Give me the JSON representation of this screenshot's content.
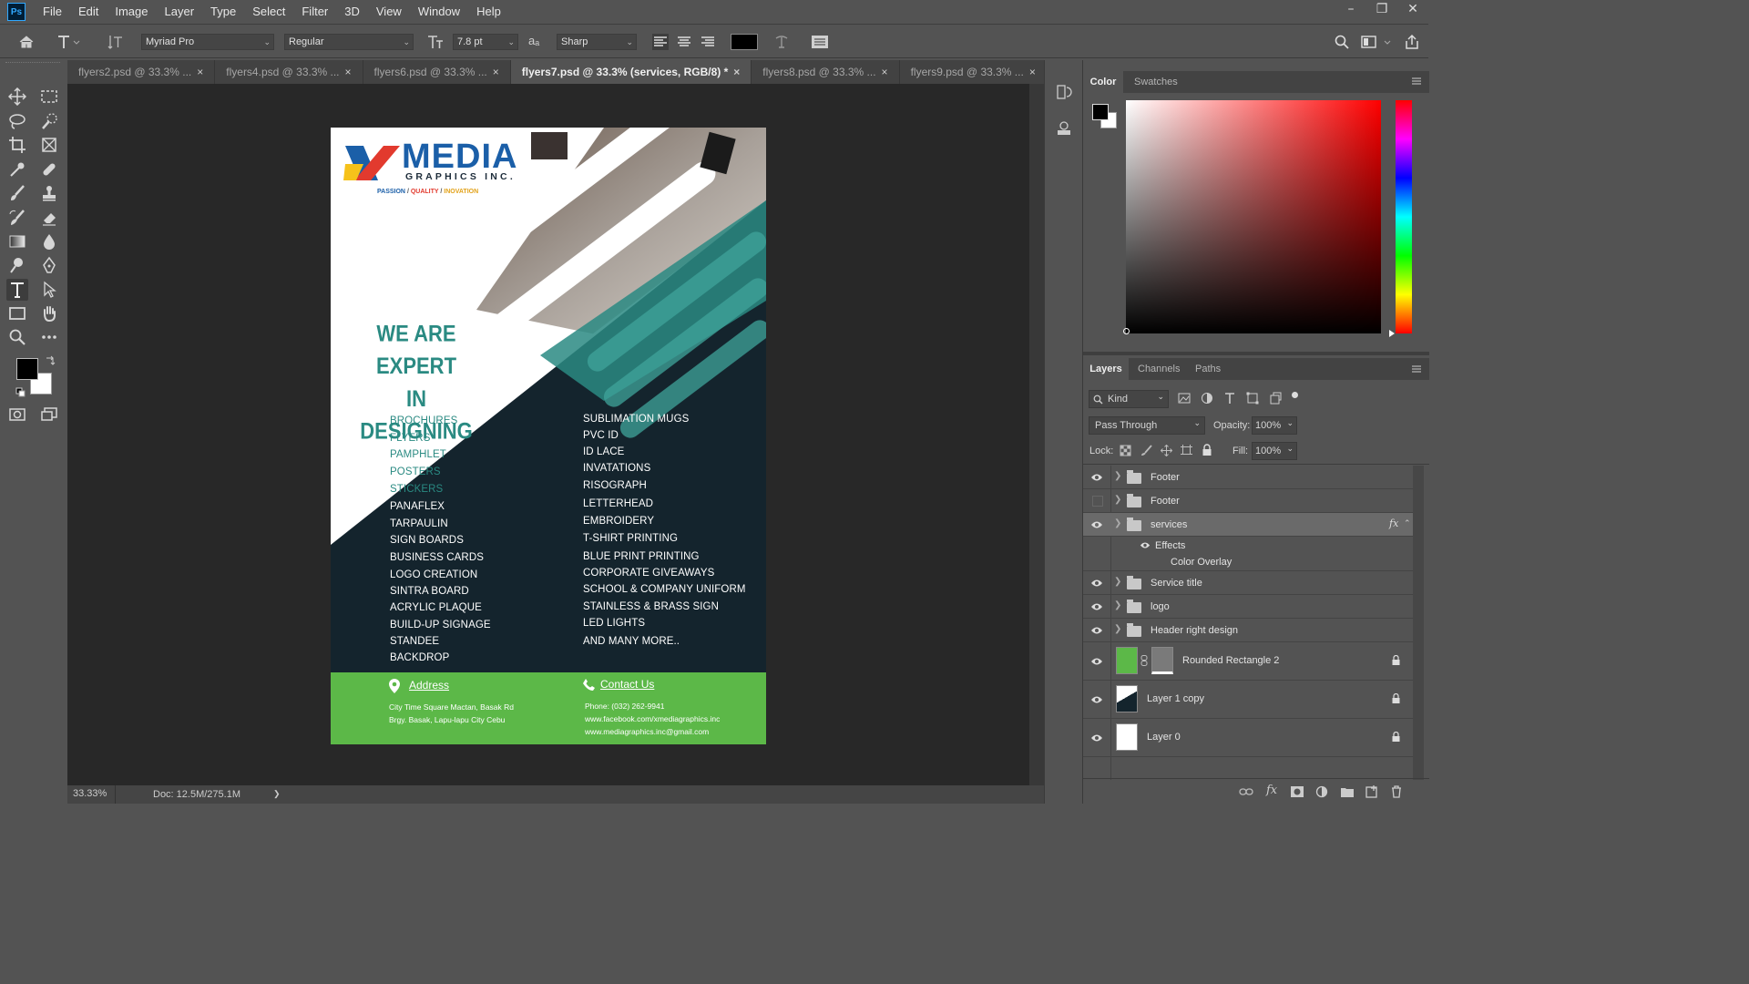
{
  "app": {
    "logo": "Ps"
  },
  "menu": [
    "File",
    "Edit",
    "Image",
    "Layer",
    "Type",
    "Select",
    "Filter",
    "3D",
    "View",
    "Window",
    "Help"
  ],
  "window_controls": [
    "–",
    "❐",
    "✕"
  ],
  "options": {
    "font_family": "Myriad Pro",
    "font_style": "Regular",
    "font_size": "7.8 pt",
    "aa_label": "aₐ",
    "antialias": "Sharp",
    "color": "#000000"
  },
  "tabs": [
    {
      "label": "flyers2.psd @ 33.3% ...",
      "active": false
    },
    {
      "label": "flyers4.psd @ 33.3% ...",
      "active": false
    },
    {
      "label": "flyers6.psd @ 33.3% ...",
      "active": false
    },
    {
      "label": "flyers7.psd @ 33.3% (services, RGB/8) *",
      "active": true
    },
    {
      "label": "flyers8.psd @ 33.3% ...",
      "active": false
    },
    {
      "label": "flyers9.psd @ 33.3% ...",
      "active": false
    }
  ],
  "tab_close": "×",
  "flyer": {
    "logo_main": "MEDIA",
    "logo_sub": "GRAPHICS INC.",
    "tagline": {
      "p1": "PASSION",
      "p2": "QUALITY",
      "p3": "INOVATION",
      "sep": " / "
    },
    "headline_1": "WE ARE EXPERT",
    "headline_2": "IN DESIGNING",
    "services_left": [
      "BROCHURES",
      "FLYERS",
      "PAMPHLET",
      "POSTERS",
      "STICKERS",
      "PANAFLEX",
      "TARPAULIN",
      "SIGN BOARDS",
      "BUSINESS CARDS",
      "LOGO CREATION",
      "SINTRA BOARD",
      "ACRYLIC PLAQUE",
      "BUILD-UP SIGNAGE",
      "STANDEE",
      "BACKDROP"
    ],
    "services_right": [
      "SUBLIMATION MUGS",
      "PVC ID",
      "ID LACE",
      "INVATATIONS",
      "RISOGRAPH",
      "LETTERHEAD",
      "EMBROIDERY",
      "T-SHIRT PRINTING",
      "BLUE PRINT PRINTING",
      "CORPORATE GIVEAWAYS",
      "SCHOOL & COMPANY UNIFORM",
      "STAINLESS & BRASS SIGN",
      "LED LIGHTS",
      "AND MANY MORE.."
    ],
    "address_title": "Address",
    "address_1": "City Time Square Mactan, Basak Rd",
    "address_2": "Brgy. Basak, Lapu-lapu City Cebu",
    "contact_title": "Contact Us",
    "phone": "Phone: (032) 262-9941",
    "facebook": "www.facebook.com/xmediagraphics.inc",
    "email": "www.mediagraphics.inc@gmail.com",
    "colors": {
      "navy": "#14242d",
      "teal": "#2a8a82",
      "green": "#5cb848",
      "logo_blue": "#1b5fa8"
    }
  },
  "status": {
    "zoom": "33.33%",
    "doc": "Doc: 12.5M/275.1M",
    "arrow": "❯"
  },
  "color_panel": {
    "tabs": [
      "Color",
      "Swatches"
    ],
    "hue_color": "#ff0000"
  },
  "layers_panel": {
    "tabs": [
      "Layers",
      "Channels",
      "Paths"
    ],
    "filter": "Kind",
    "blend_mode": "Pass Through",
    "opacity_label": "Opacity:",
    "opacity": "100%",
    "lock_label": "Lock:",
    "fill_label": "Fill:",
    "fill": "100%",
    "fx": "fx",
    "layers": [
      {
        "name": "Footer",
        "type": "folder",
        "visible": true
      },
      {
        "name": "Footer",
        "type": "folder",
        "visible": false
      },
      {
        "name": "services",
        "type": "folder",
        "visible": true,
        "selected": true
      },
      {
        "name": "Effects",
        "type": "effects"
      },
      {
        "name": "Color Overlay",
        "type": "effect"
      },
      {
        "name": "Service title",
        "type": "folder",
        "visible": true
      },
      {
        "name": "logo",
        "type": "folder",
        "visible": true
      },
      {
        "name": "Header right design",
        "type": "folder",
        "visible": true
      },
      {
        "name": "Rounded Rectangle 2",
        "type": "shape",
        "visible": true
      },
      {
        "name": "Layer 1 copy",
        "type": "pixel",
        "visible": true
      },
      {
        "name": "Layer 0",
        "type": "pixel",
        "visible": true
      }
    ]
  }
}
